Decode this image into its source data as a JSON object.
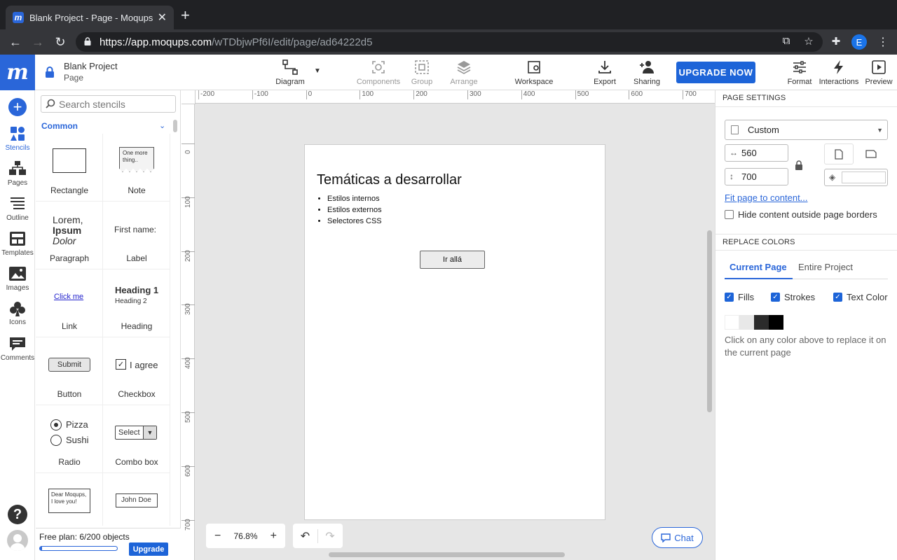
{
  "browser": {
    "tab_title": "Blank Project - Page - Moqups",
    "url_host": "https://app.moqups.com",
    "url_path": "/wTDbjwPf6I/edit/page/ad64222d5",
    "profile_initial": "E"
  },
  "app": {
    "logo": "m",
    "project_name": "Blank Project",
    "page_name": "Page",
    "toolbar": {
      "diagram": "Diagram",
      "components": "Components",
      "group": "Group",
      "arrange": "Arrange",
      "workspace": "Workspace",
      "export": "Export",
      "sharing": "Sharing",
      "upgrade": "UPGRADE NOW",
      "format": "Format",
      "interactions": "Interactions",
      "preview": "Preview"
    }
  },
  "rail": {
    "stencils": "Stencils",
    "pages": "Pages",
    "outline": "Outline",
    "templates": "Templates",
    "images": "Images",
    "icons": "Icons",
    "comments": "Comments"
  },
  "stencils": {
    "search_placeholder": "Search stencils",
    "category": "Common",
    "items": [
      {
        "label": "Rectangle"
      },
      {
        "label": "Note",
        "preview": "One more thing.."
      },
      {
        "label": "Paragraph",
        "preview_1": "Lorem,",
        "preview_2": "Ipsum",
        "preview_3": "Dolor"
      },
      {
        "label": "Label",
        "preview": "First name:"
      },
      {
        "label": "Link",
        "preview": "Click me"
      },
      {
        "label": "Heading",
        "preview_1": "Heading 1",
        "preview_2": "Heading 2"
      },
      {
        "label": "Button",
        "preview": "Submit"
      },
      {
        "label": "Checkbox",
        "preview": "I agree"
      },
      {
        "label": "Radio",
        "preview_1": "Pizza",
        "preview_2": "Sushi"
      },
      {
        "label": "Combo box",
        "preview": "Select"
      },
      {
        "preview": "Dear Moqups, I love you!"
      },
      {
        "preview": "John Doe"
      }
    ],
    "plan_text": "Free plan: 6/200 objects",
    "plan_fraction": 0.03,
    "plan_upgrade": "Upgrade"
  },
  "canvas": {
    "ruler_h": [
      "-200",
      "-100",
      "0",
      "100",
      "200",
      "300",
      "400",
      "500",
      "600",
      "700"
    ],
    "ruler_v": [
      "0",
      "100",
      "200",
      "300",
      "400",
      "500",
      "600",
      "700"
    ],
    "page": {
      "title": "Temáticas a desarrollar",
      "bullets": [
        "Estilos internos",
        "Estilos externos",
        "Selectores CSS"
      ],
      "button": "Ir allá"
    },
    "zoom": "76.8%",
    "chat": "Chat"
  },
  "right_panel": {
    "page_settings": "PAGE SETTINGS",
    "preset": "Custom",
    "width": "560",
    "height": "700",
    "fit_link": "Fit page to content...",
    "hide_outside": "Hide content outside page borders",
    "replace_colors": "REPLACE COLORS",
    "tab_current": "Current Page",
    "tab_entire": "Entire Project",
    "fills": "Fills",
    "strokes": "Strokes",
    "text_color": "Text Color",
    "colors": [
      "#ffffff",
      "#e8e8e8",
      "#2b2b2b",
      "#000000"
    ],
    "hint": "Click on any color above to replace it on the current page"
  }
}
